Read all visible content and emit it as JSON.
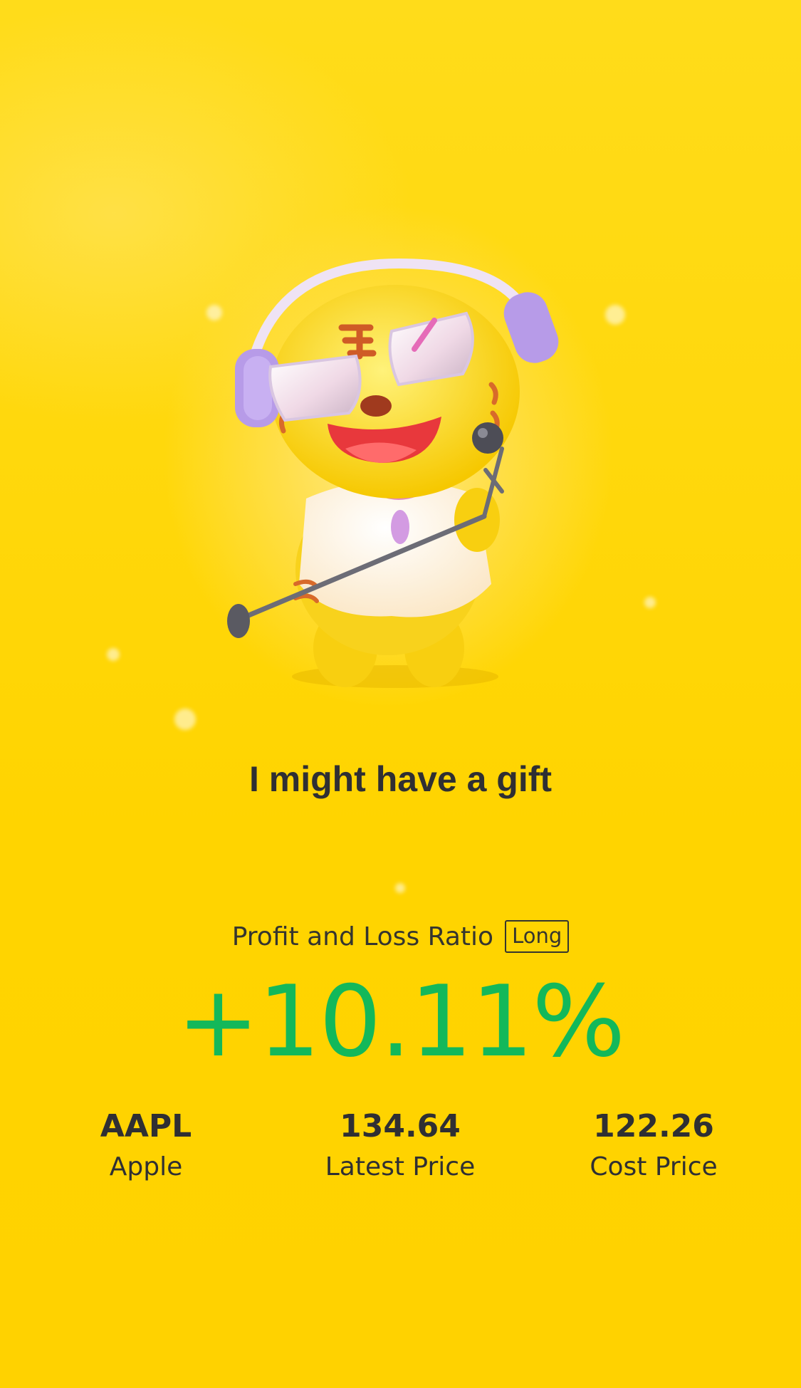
{
  "page": {
    "title": "I might have a gift",
    "mascot_icon": "tiger-singer-mascot"
  },
  "pl": {
    "label": "Profit and Loss Ratio",
    "badge": "Long",
    "value": "+10.11%",
    "value_color": "#13b85a"
  },
  "stats": [
    {
      "top": "AAPL",
      "bottom": "Apple"
    },
    {
      "top": "134.64",
      "bottom": "Latest Price"
    },
    {
      "top": "122.26",
      "bottom": "Cost Price"
    }
  ],
  "colors": {
    "background": "#ffd400",
    "text": "#2f2f33"
  }
}
